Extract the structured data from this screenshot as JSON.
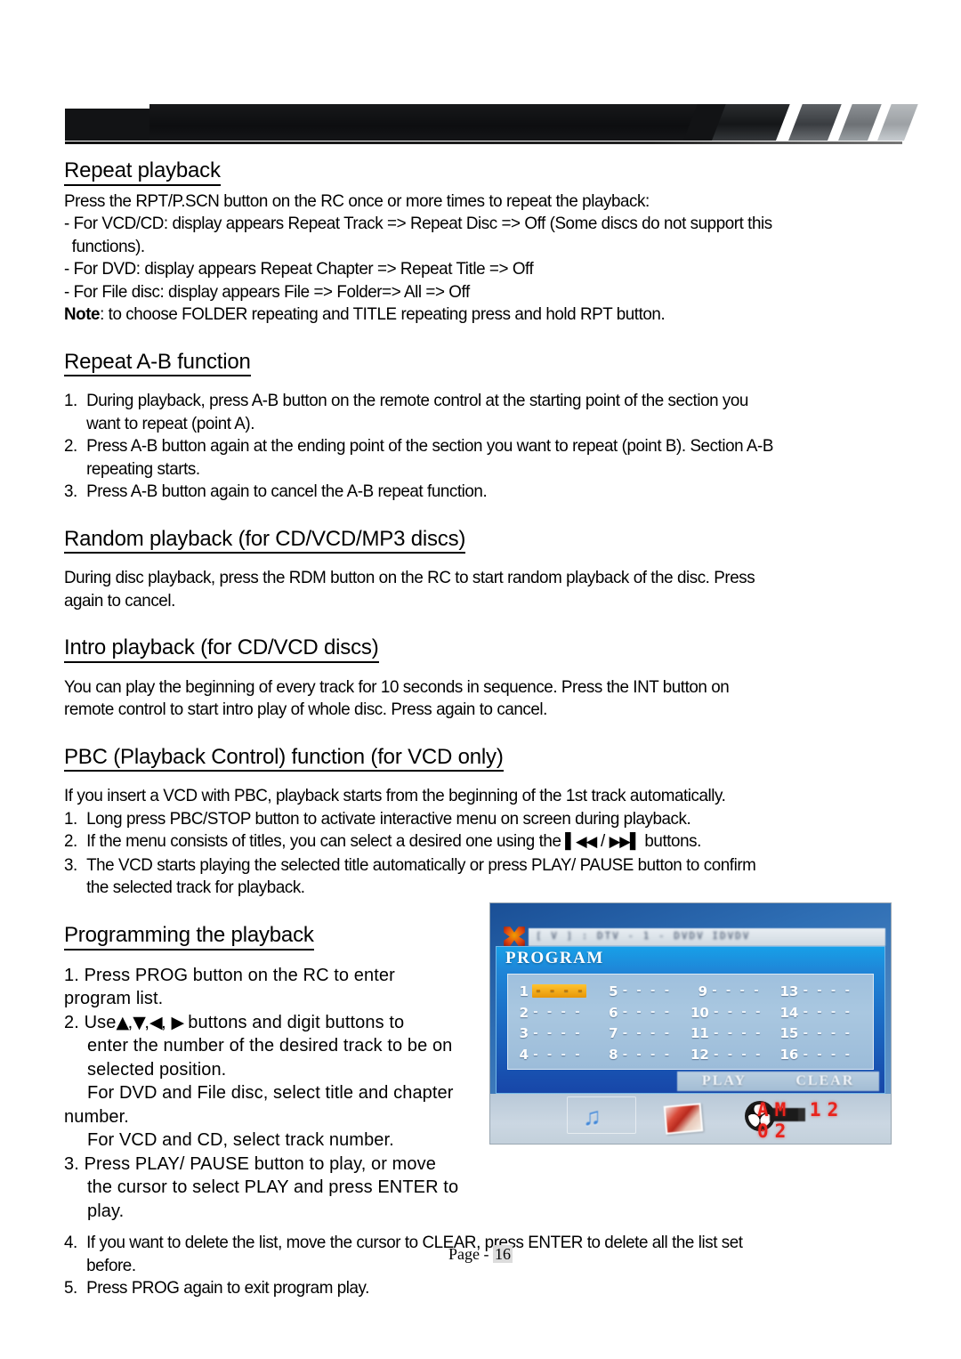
{
  "document": {
    "page_footer_label": "Page -",
    "page_number": "16"
  },
  "sections": [
    {
      "title": "Repeat playback",
      "lines": [
        "Press the RPT/P.SCN button on the RC once or more times to repeat the playback:",
        "- For VCD/CD: display appears Repeat Track => Repeat Disc => Off (Some discs do not support this",
        "functions).",
        "- For DVD: display appears Repeat Chapter => Repeat Title => Off",
        "- For File disc: display appears File => Folder=> All => Off"
      ],
      "note_label": "Note",
      "note_text": ": to choose FOLDER repeating and TITLE repeating press and hold RPT button."
    },
    {
      "title": "Repeat A-B function",
      "items": [
        {
          "mark": "1.",
          "line1": "During playback, press A-B button on the remote control at the starting point of the section you",
          "line2": "want to repeat (point A)."
        },
        {
          "mark": "2.",
          "line1": "Press A-B button again at the ending point of the section you want to repeat (point B). Section A-B",
          "line2": "repeating starts."
        },
        {
          "mark": "3.",
          "line1": "Press A-B button again to cancel the A-B repeat function.",
          "line2": ""
        }
      ]
    },
    {
      "title": "Random playback (for CD/VCD/MP3 discs)",
      "lines": [
        "During disc playback, press the RDM button on the RC to start random playback of the disc. Press",
        "again to cancel."
      ]
    },
    {
      "title": "Intro playback (for CD/VCD discs)",
      "lines": [
        "You can play the beginning of every track for 10 seconds in sequence. Press the INT button on",
        "remote control to start intro play of whole disc. Press again to cancel."
      ]
    },
    {
      "title": "PBC (Playback Control) function (for VCD only)",
      "intro": "If you insert a VCD with PBC, playback starts from the beginning of the 1st track automatically.",
      "items": [
        {
          "mark": "1.",
          "text": "Long press PBC/STOP button to activate interactive menu on screen during playback."
        }
      ],
      "item2": {
        "mark": "2.",
        "before": "If the menu consists of titles, you can select a desired one using the",
        "glyph_prev": "▌◀◀",
        "separator": "/",
        "glyph_next": "▶▶▌",
        "after": "buttons."
      },
      "item3": {
        "mark": "3.",
        "line1": "The VCD starts playing the selected title automatically or press PLAY/ PAUSE button to confirm",
        "line2": "the selected track for playback."
      }
    },
    {
      "title": "Programming the playback",
      "item1": {
        "mark": "1.",
        "line1": "Press PROG button on the RC to enter",
        "line2": "program list."
      },
      "item2": {
        "mark": "2.",
        "use_word": "Use",
        "glyph_up": "▲",
        "glyph_down": "▼",
        "glyph_left": "◀",
        "glyph_right": "▶",
        "after": "buttons and digit buttons to",
        "line2": "enter the number of the desired track to be on",
        "line3": "selected position.",
        "line4": "For DVD and File disc, select title and chapter",
        "line5": "number.",
        "line6": "For VCD and CD, select track number."
      },
      "item3": {
        "mark": "3.",
        "line1": "Press PLAY/ PAUSE button to play, or move",
        "line2": "the cursor to select PLAY and press ENTER to",
        "line3": "play."
      },
      "item4": {
        "mark": "4.",
        "line1": "If you want to delete the list, move the cursor to CLEAR, press ENTER to delete all the list set",
        "line2": "before."
      },
      "item5": {
        "mark": "5.",
        "line1": "Press PROG again to exit program play."
      }
    }
  ],
  "photo": {
    "alt_caption": "PROGRAM menu on TV screen",
    "topbar_text": "[ V ]    :    DTV - 1 - DVDV   IDVDV",
    "panel_title": "PROGRAM",
    "grid": [
      {
        "num": "1",
        "dashes": "- - - -",
        "selected": true
      },
      {
        "num": "5",
        "dashes": "- - - -",
        "selected": false
      },
      {
        "num": "9",
        "dashes": "- - - -",
        "selected": false
      },
      {
        "num": "13",
        "dashes": "- - - -",
        "selected": false
      },
      {
        "num": "2",
        "dashes": "- - - -",
        "selected": false
      },
      {
        "num": "6",
        "dashes": "- - - -",
        "selected": false
      },
      {
        "num": "10",
        "dashes": "- - - -",
        "selected": false
      },
      {
        "num": "14",
        "dashes": "- - - -",
        "selected": false
      },
      {
        "num": "3",
        "dashes": "- - - -",
        "selected": false
      },
      {
        "num": "7",
        "dashes": "- - - -",
        "selected": false
      },
      {
        "num": "11",
        "dashes": "- - - -",
        "selected": false
      },
      {
        "num": "15",
        "dashes": "- - - -",
        "selected": false
      },
      {
        "num": "4",
        "dashes": "- - - -",
        "selected": false
      },
      {
        "num": "8",
        "dashes": "- - - -",
        "selected": false
      },
      {
        "num": "12",
        "dashes": "- - - -",
        "selected": false
      },
      {
        "num": "16",
        "dashes": "- - - -",
        "selected": false
      }
    ],
    "play_button": "PLAY",
    "clear_button": "CLEAR",
    "music_icon": "♫",
    "led_time": "AM 12 02",
    "accent_blue": "#1f86d8",
    "highlight_orange": "#e79608",
    "led_red": "#e8231c"
  }
}
